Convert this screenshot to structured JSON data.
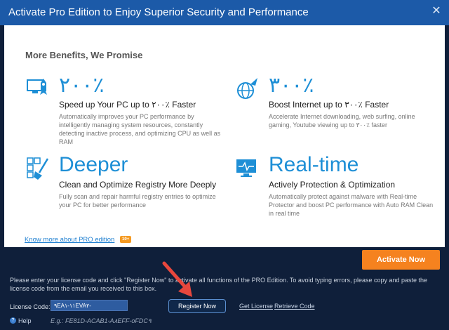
{
  "window": {
    "title": "Activate Pro Edition to Enjoy Superior Security and Performance"
  },
  "content": {
    "heading": "More Benefits, We Promise",
    "benefits": [
      {
        "icon": "rocket-monitor-icon",
        "big": "٢٠٠٪",
        "sub": "Speed up Your PC up to ٢٠٠٪ Faster",
        "desc": "Automatically improves your PC performance by intelligently managing system resources, constantly detecting inactive process, and optimizing CPU as well as RAM"
      },
      {
        "icon": "globe-rocket-icon",
        "big": "٣٠٠٪",
        "sub": "Boost Internet up to ٣٠٠٪ Faster",
        "desc": "Accelerate Internet downloading, web surfing, online gaming, Youtube viewing up to ٣٠٠٪ faster"
      },
      {
        "icon": "registry-broom-icon",
        "big": "Deeper",
        "sub": "Clean and Optimize Registry More Deeply",
        "desc": "Fully scan and repair harmful registry entries to optimize your PC for better performance"
      },
      {
        "icon": "realtime-monitor-icon",
        "big": "Real-time",
        "sub": "Actively Protection & Optimization",
        "desc": "Automatically protect against malware with Real-time Protector and boost PC performance with Auto RAM Clean in real time"
      }
    ],
    "know_more": "Know more about PRO edition",
    "badge": "10+"
  },
  "footer": {
    "activate_label": "Activate Now",
    "info": "Please enter your license code and click \"Register Now\" to activate all functions of the PRO Edition. To avoid typing errors, please copy and paste the license code from the email you received to this box.",
    "license_label": "License Code:",
    "license_value": "٩EA١١-١EVA٢-",
    "register_label": "Register Now",
    "get_license": "Get License",
    "retrieve_code": "Retrieve Code",
    "help": "Help",
    "example": "E.g.: FE81D-ACAB1-A٨EFF-oFDC٩"
  },
  "colors": {
    "titlebar": "#1c5aa8",
    "accent_blue": "#1e8fd6",
    "activate_orange": "#f5821f",
    "arrow_red": "#e8473d"
  }
}
